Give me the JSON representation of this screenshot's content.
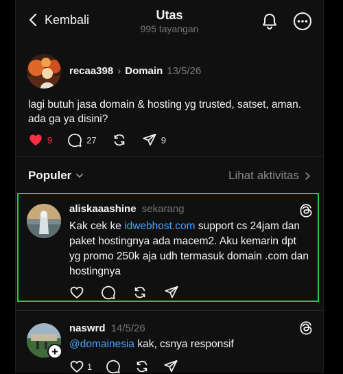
{
  "header": {
    "back_label": "Kembali",
    "title": "Utas",
    "views": "995 tayangan"
  },
  "post": {
    "username": "recaa398",
    "topic": "Domain",
    "date": "13/5/26",
    "text": "lagi butuh jasa domain & hosting yg trusted, satset, aman. ada ga ya disini?",
    "likes": "9",
    "comments": "27",
    "shares": "9",
    "like_color": "#ff3040"
  },
  "sort": {
    "label": "Populer",
    "activity_label": "Lihat aktivitas"
  },
  "replies": [
    {
      "username": "aliskaaashine",
      "time": "sekarang",
      "text_before": "Kak cek ke ",
      "link": "idwebhost.com",
      "text_after": " support cs 24jam dan paket hostingnya ada macem2. Aku kemarin dpt yg promo 250k aja udh termasuk domain .com dan hostingnya"
    },
    {
      "username": "naswrd",
      "time": "14/5/26",
      "mention": "@domainesia",
      "text_after": " kak, csnya responsif",
      "likes": "1"
    }
  ],
  "colors": {
    "link": "#4aa3ff",
    "highlight_border": "#27c93f"
  }
}
